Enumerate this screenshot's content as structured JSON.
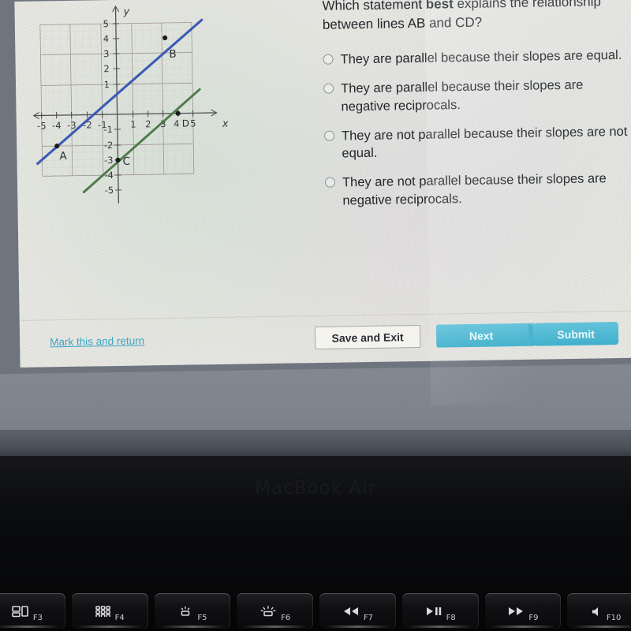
{
  "question": {
    "prefix": "Which statement ",
    "emphasis": "best",
    "suffix": " explains the relationship between lines AB and CD?"
  },
  "options": [
    {
      "id": "opt-a",
      "label": "They are parallel because their slopes are equal."
    },
    {
      "id": "opt-b",
      "label": "They are parallel because their slopes are negative reciprocals."
    },
    {
      "id": "opt-c",
      "label": "They are not parallel because their slopes are not equal."
    },
    {
      "id": "opt-d",
      "label": "They are not parallel because their slopes are negative reciprocals."
    }
  ],
  "footer": {
    "mark_link": "Mark this and return",
    "save_exit_label": "Save and Exit",
    "next_label": "Next",
    "submit_label": "Submit"
  },
  "chart_data": {
    "type": "line",
    "title": "",
    "xlabel": "x",
    "ylabel": "y",
    "xlim": [
      -5.6,
      5.6
    ],
    "ylim": [
      -5.6,
      5.6
    ],
    "xticks": [
      -5,
      -4,
      -3,
      -2,
      -1,
      1,
      2,
      3,
      4,
      5
    ],
    "yticks": [
      5,
      4,
      3,
      2,
      1,
      -1,
      -2,
      -3,
      -4,
      -5
    ],
    "grid": true,
    "axis_arrows": true,
    "series": [
      {
        "name": "AB",
        "color": "#3b5bb5",
        "points": [
          [
            -5.2,
            -3.2
          ],
          [
            4.4,
            5.0
          ]
        ],
        "labeled_points": [
          {
            "label": "A",
            "x": -4,
            "y": -2
          },
          {
            "label": "B",
            "x": 3.2,
            "y": 4
          }
        ]
      },
      {
        "name": "CD",
        "color": "#4e7a4a",
        "points": [
          [
            -2.2,
            -5.1
          ],
          [
            4.9,
            1.3
          ]
        ],
        "labeled_points": [
          {
            "label": "C",
            "x": 0,
            "y": -3
          },
          {
            "label": "D",
            "x": 4,
            "y": 0
          }
        ]
      }
    ]
  },
  "laptop": {
    "wordmark": "MacBook Air",
    "fn_keys": [
      {
        "name": "mission-control-key",
        "label": "F3",
        "icon": "mission-control-icon"
      },
      {
        "name": "launchpad-key",
        "label": "F4",
        "icon": "launchpad-grid-icon"
      },
      {
        "name": "keyboard-brightness-down-key",
        "label": "F5",
        "icon": "keyboard-backlight-down-icon"
      },
      {
        "name": "keyboard-brightness-up-key",
        "label": "F6",
        "icon": "keyboard-backlight-up-icon"
      },
      {
        "name": "rewind-key",
        "label": "F7",
        "icon": "rewind-icon"
      },
      {
        "name": "play-pause-key",
        "label": "F8",
        "icon": "play-pause-icon"
      },
      {
        "name": "fast-forward-key",
        "label": "F9",
        "icon": "fast-forward-icon"
      },
      {
        "name": "mute-key",
        "label": "F10",
        "icon": "mute-speaker-icon"
      }
    ]
  }
}
